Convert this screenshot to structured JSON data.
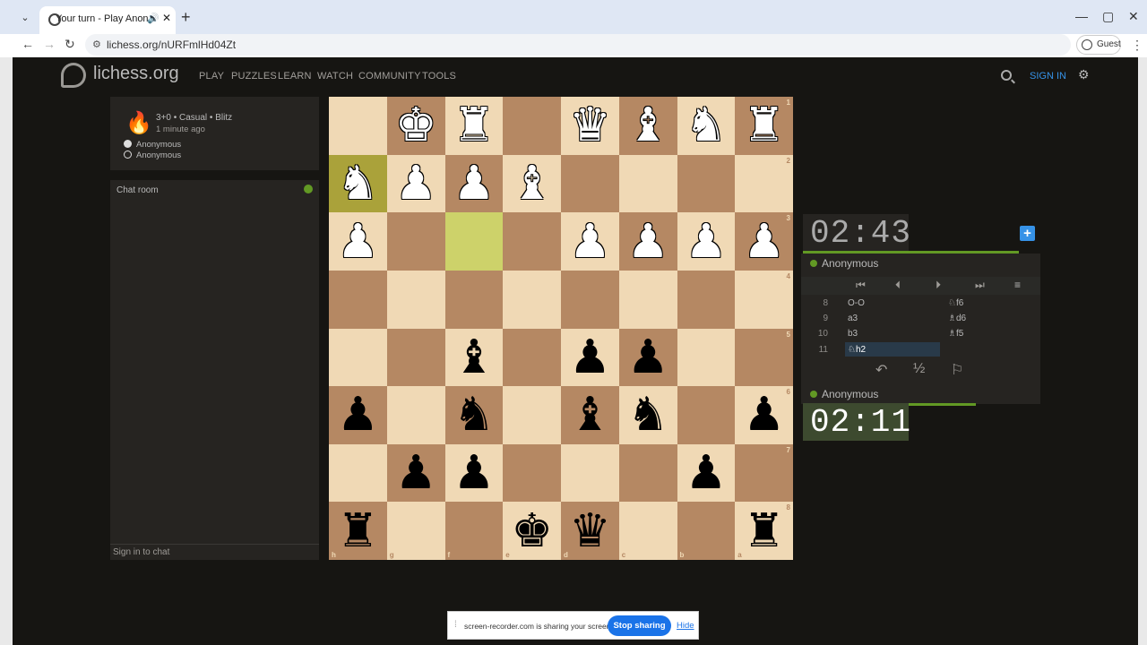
{
  "browser": {
    "tab_title": "Your turn - Play Anon... • lich",
    "url": "lichess.org/nURFmlHd04Zt",
    "guest_label": "Guest",
    "icons": [
      "tab-menu-icon",
      "audio-icon",
      "close-icon",
      "plus-icon",
      "back-icon",
      "forward-icon",
      "reload-icon",
      "site-info-icon",
      "kebab-icon",
      "minimize-icon",
      "maximize-icon"
    ]
  },
  "header": {
    "logo": "lichess.org",
    "nav": [
      "PLAY",
      "PUZZLES",
      "LEARN",
      "WATCH",
      "COMMUNITY",
      "TOOLS"
    ],
    "sign_in": "SIGN IN",
    "accent": "#3692e7"
  },
  "game": {
    "type": "3+0 • Casual • Blitz",
    "time_ago": "1 minute ago",
    "players": [
      {
        "name": "Anonymous",
        "color": "white"
      },
      {
        "name": "Anonymous",
        "color": "black"
      }
    ]
  },
  "chat": {
    "title": "Chat room",
    "input_placeholder": "Sign in to chat"
  },
  "board": {
    "orientation": "black",
    "ranks": [
      "1",
      "2",
      "3",
      "4",
      "5",
      "6",
      "7",
      "8"
    ],
    "files": [
      "h",
      "g",
      "f",
      "e",
      "d",
      "c",
      "b",
      "a"
    ],
    "rows": [
      [
        "",
        "wK",
        "wR",
        "",
        "wQ",
        "wB",
        "wN",
        "wR"
      ],
      [
        "wN*",
        "wP",
        "wP",
        "wB",
        "",
        "",
        "",
        ""
      ],
      [
        "wP",
        "",
        "*",
        "",
        "wP",
        "wP",
        "wP",
        "wP"
      ],
      [
        "",
        "",
        "",
        "",
        "",
        "",
        "",
        ""
      ],
      [
        "",
        "",
        "bB",
        "",
        "bP",
        "bP",
        "",
        ""
      ],
      [
        "bP",
        "",
        "bN",
        "",
        "bB",
        "bN",
        "",
        "bP"
      ],
      [
        "",
        "bP",
        "bP",
        "",
        "",
        "",
        "bP",
        ""
      ],
      [
        "bR",
        "",
        "",
        "bK",
        "bQ",
        "",
        "",
        "bR"
      ]
    ],
    "colors": {
      "light": "#f0d9b5",
      "dark": "#b58863",
      "highlight_light": "#cdd26a",
      "highlight_dark": "#aaa23a"
    }
  },
  "clocks": {
    "opponent": "02:43",
    "player": "02:11",
    "opponent_bar_fraction": 0.9,
    "player_bar_fraction": 0.6
  },
  "opponent_name": "Anonymous",
  "player_name": "Anonymous",
  "moves": [
    {
      "num": "8",
      "white": "O-O",
      "black": "♘f6"
    },
    {
      "num": "9",
      "white": "a3",
      "black": "♗d6"
    },
    {
      "num": "10",
      "white": "b3",
      "black": "♗f5"
    },
    {
      "num": "11",
      "white": "♘h2",
      "black": ""
    }
  ],
  "controls": {
    "first": "⏮",
    "prev": "⏴",
    "next": "⏵",
    "last": "⏭",
    "menu": "≡",
    "takeback": "↶",
    "draw": "½",
    "resign": "⚐"
  },
  "share_bar": {
    "text": "screen-recorder.com is sharing your screen.",
    "stop": "Stop sharing",
    "hide": "Hide"
  }
}
